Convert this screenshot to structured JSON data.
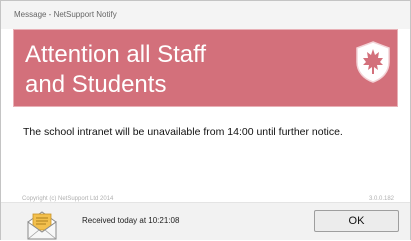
{
  "window": {
    "title": "Message - NetSupport Notify"
  },
  "banner": {
    "headline_line1": "Attention all Staff",
    "headline_line2": "and Students",
    "icon": "shield-maple-leaf-icon",
    "background_color": "#d3707b"
  },
  "message": {
    "body": "The school intranet will be unavailable from 14:00 until further notice."
  },
  "footer": {
    "copyright": "Copyright (c) NetSupport Ltd 2014",
    "version": "3.0.0.182"
  },
  "statusbar": {
    "icon": "envelope-icon",
    "received": "Received today at 10:21:08",
    "ok_label": "OK"
  }
}
